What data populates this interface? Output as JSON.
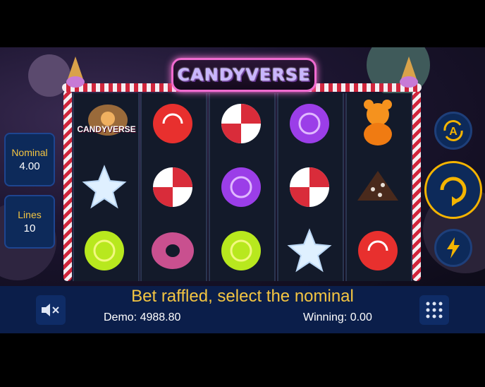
{
  "game": {
    "title": "CANDYVERSE"
  },
  "reels": [
    [
      "candyverse-logo-symbol",
      "white-star-candy",
      "green-swirl-candy"
    ],
    [
      "red-round-candy",
      "peppermint-swirl-candy",
      "glazed-donut"
    ],
    [
      "peppermint-swirl-candy",
      "purple-swirl-candy",
      "green-swirl-candy"
    ],
    [
      "purple-swirl-candy",
      "peppermint-swirl-candy",
      "white-star-candy"
    ],
    [
      "orange-gummy-bear",
      "chocolate-chip-cake",
      "red-round-candy"
    ]
  ],
  "symbol_text": {
    "logo_symbol": "CANDYVERSE"
  },
  "nominal": {
    "label": "Nominal",
    "value": "4.00"
  },
  "lines": {
    "label": "Lines",
    "value": "10"
  },
  "status_message": "Bet raffled, select the nominal",
  "demo": {
    "label": "Demo:",
    "value": "4988.80"
  },
  "winning": {
    "label": "Winning:",
    "value": "0.00"
  },
  "buttons": {
    "autoplay_letter": "A"
  },
  "colors": {
    "accent": "#f4c542",
    "panel": "#0b1e4a",
    "button_ring": "#f4b400"
  }
}
